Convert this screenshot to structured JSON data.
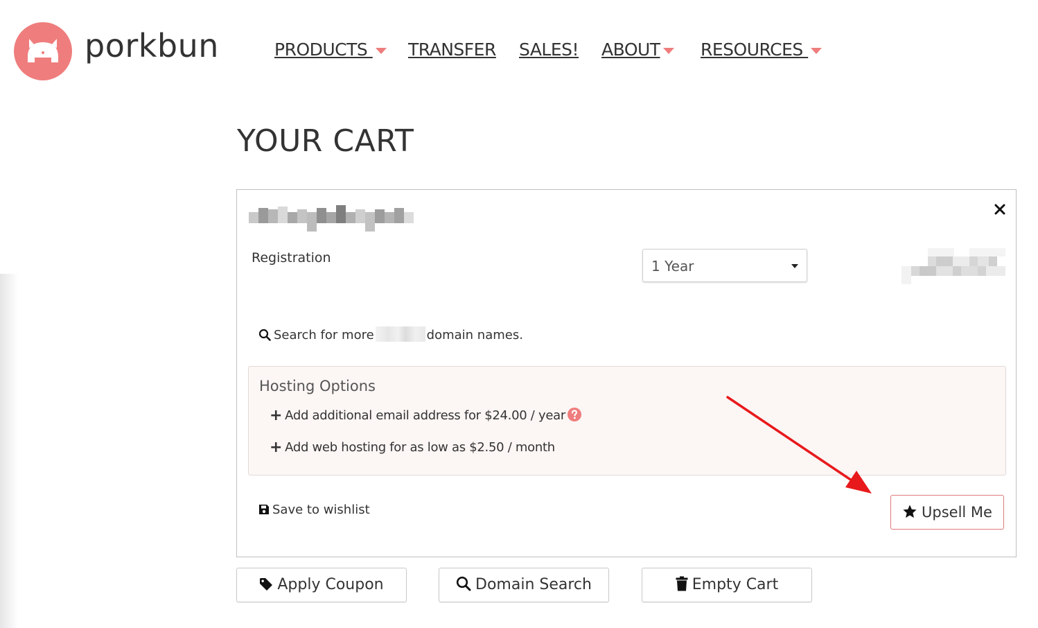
{
  "brand": {
    "name": "porkbun",
    "logo_icon": "pig-logo-icon",
    "logo_color": "#ef7d7d"
  },
  "nav": {
    "items": [
      {
        "label": "PRODUCTS ",
        "has_dropdown": true
      },
      {
        "label": "TRANSFER",
        "has_dropdown": false
      },
      {
        "label": "SALES!",
        "has_dropdown": false
      },
      {
        "label": "ABOUT",
        "has_dropdown": true
      },
      {
        "label": "RESOURCES ",
        "has_dropdown": true
      }
    ],
    "caret_color": "#ef7d7d"
  },
  "page": {
    "title": "YOUR CART"
  },
  "cart_item": {
    "registration_label": "Registration",
    "term_selected": "1 Year",
    "search_more_prefix": "Search for more",
    "search_more_suffix": "domain names.",
    "hosting": {
      "title": "Hosting Options",
      "options": [
        "Add additional email address for $24.00 / year",
        "Add web hosting for as low as $2.50 / month"
      ]
    },
    "save_wishlist": "Save to wishlist",
    "upsell_label": "Upsell Me"
  },
  "actions": {
    "apply_coupon": "Apply Coupon",
    "domain_search": "Domain Search",
    "empty_cart": "Empty Cart"
  },
  "colors": {
    "accent": "#ef7d7d",
    "annotation_arrow": "#e8191b",
    "hosting_bg": "#fcf6f5"
  }
}
